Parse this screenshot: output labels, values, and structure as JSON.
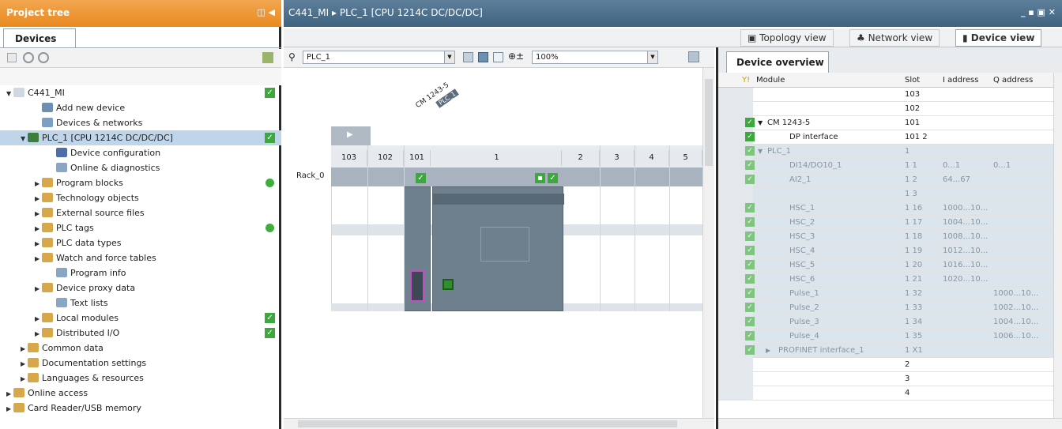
{
  "project_tree": {
    "title": "Project tree",
    "devices_tab": "Devices",
    "items": [
      {
        "label": "C441_MI",
        "indent": 0,
        "arrow": "▼",
        "icon": "project-icon",
        "color": "#cfd8e2",
        "status": "check"
      },
      {
        "label": "Add new device",
        "indent": 2,
        "arrow": "",
        "icon": "add-device-icon",
        "color": "#6d8fb3",
        "status": ""
      },
      {
        "label": "Devices & networks",
        "indent": 2,
        "arrow": "",
        "icon": "network-icon",
        "color": "#7aa0c4",
        "status": ""
      },
      {
        "label": "PLC_1 [CPU 1214C DC/DC/DC]",
        "indent": 1,
        "arrow": "▼",
        "icon": "plc-icon",
        "color": "#3f7d3f",
        "status": "check",
        "selected": true
      },
      {
        "label": "Device configuration",
        "indent": 3,
        "arrow": "",
        "icon": "device-config-icon",
        "color": "#4b6fa6",
        "status": ""
      },
      {
        "label": "Online & diagnostics",
        "indent": 3,
        "arrow": "",
        "icon": "diagnostics-icon",
        "color": "#8aa6c3",
        "status": ""
      },
      {
        "label": "Program blocks",
        "indent": 2,
        "arrow": "▶",
        "icon": "folder-icon",
        "color": "#d6a84a",
        "status": "dot"
      },
      {
        "label": "Technology objects",
        "indent": 2,
        "arrow": "▶",
        "icon": "folder-icon",
        "color": "#d6a84a",
        "status": ""
      },
      {
        "label": "External source files",
        "indent": 2,
        "arrow": "▶",
        "icon": "folder-icon",
        "color": "#d6a84a",
        "status": ""
      },
      {
        "label": "PLC tags",
        "indent": 2,
        "arrow": "▶",
        "icon": "folder-icon",
        "color": "#d6a84a",
        "status": "dot"
      },
      {
        "label": "PLC data types",
        "indent": 2,
        "arrow": "▶",
        "icon": "folder-icon",
        "color": "#d6a84a",
        "status": ""
      },
      {
        "label": "Watch and force tables",
        "indent": 2,
        "arrow": "▶",
        "icon": "folder-icon",
        "color": "#d6a84a",
        "status": ""
      },
      {
        "label": "Program info",
        "indent": 3,
        "arrow": "",
        "icon": "info-icon",
        "color": "#8aa6c3",
        "status": ""
      },
      {
        "label": "Device proxy data",
        "indent": 2,
        "arrow": "▶",
        "icon": "folder-icon",
        "color": "#d6a84a",
        "status": ""
      },
      {
        "label": "Text lists",
        "indent": 3,
        "arrow": "",
        "icon": "list-icon",
        "color": "#8aa6c3",
        "status": ""
      },
      {
        "label": "Local modules",
        "indent": 2,
        "arrow": "▶",
        "icon": "folder-icon",
        "color": "#d6a84a",
        "status": "check"
      },
      {
        "label": "Distributed I/O",
        "indent": 2,
        "arrow": "▶",
        "icon": "folder-icon",
        "color": "#d6a84a",
        "status": "check"
      },
      {
        "label": "Common data",
        "indent": 1,
        "arrow": "▶",
        "icon": "folder-icon",
        "color": "#d6a84a",
        "status": ""
      },
      {
        "label": "Documentation settings",
        "indent": 1,
        "arrow": "▶",
        "icon": "folder-icon",
        "color": "#d6a84a",
        "status": ""
      },
      {
        "label": "Languages & resources",
        "indent": 1,
        "arrow": "▶",
        "icon": "folder-icon",
        "color": "#d6a84a",
        "status": ""
      },
      {
        "label": "Online access",
        "indent": 0,
        "arrow": "▶",
        "icon": "folder-icon",
        "color": "#d6a84a",
        "status": ""
      },
      {
        "label": "Card Reader/USB memory",
        "indent": 0,
        "arrow": "▶",
        "icon": "folder-icon",
        "color": "#d6a84a",
        "status": ""
      }
    ]
  },
  "editor": {
    "breadcrumb": "C441_MI  ▸  PLC_1 [CPU 1214C DC/DC/DC]",
    "views": {
      "topology": "Topology view",
      "network": "Network view",
      "device": "Device view"
    },
    "device_select": "PLC_1",
    "zoom": "100%",
    "rack_label": "Rack_0",
    "module_label_a": "CM 1243-5",
    "module_label_b": "PLC_1",
    "slots": [
      "103",
      "102",
      "101",
      "1",
      "2",
      "3",
      "4",
      "5"
    ]
  },
  "device_overview": {
    "tab": "Device overview",
    "headers": {
      "module": "Module",
      "slot": "Slot",
      "iaddr": "I address",
      "qaddr": "Q address"
    },
    "rows": [
      {
        "module": "",
        "slot": "103",
        "i": "",
        "q": "",
        "chk": false,
        "grey": false,
        "ind": 0,
        "arrow": ""
      },
      {
        "module": "",
        "slot": "102",
        "i": "",
        "q": "",
        "chk": false,
        "grey": false,
        "ind": 0,
        "arrow": ""
      },
      {
        "module": "CM 1243-5",
        "slot": "101",
        "i": "",
        "q": "",
        "chk": true,
        "grey": false,
        "ind": 0,
        "arrow": "▼"
      },
      {
        "module": "DP interface",
        "slot": "101 2",
        "i": "",
        "q": "",
        "chk": true,
        "grey": false,
        "ind": 2,
        "arrow": ""
      },
      {
        "module": "PLC_1",
        "slot": "1",
        "i": "",
        "q": "",
        "chk": true,
        "grey": true,
        "ind": 0,
        "arrow": "▼"
      },
      {
        "module": "DI14/DO10_1",
        "slot": "1 1",
        "i": "0...1",
        "q": "0...1",
        "chk": true,
        "grey": true,
        "ind": 2,
        "arrow": ""
      },
      {
        "module": "AI2_1",
        "slot": "1 2",
        "i": "64...67",
        "q": "",
        "chk": true,
        "grey": true,
        "ind": 2,
        "arrow": ""
      },
      {
        "module": "",
        "slot": "1 3",
        "i": "",
        "q": "",
        "chk": false,
        "grey": true,
        "ind": 2,
        "arrow": ""
      },
      {
        "module": "HSC_1",
        "slot": "1 16",
        "i": "1000...10...",
        "q": "",
        "chk": true,
        "grey": true,
        "ind": 2,
        "arrow": ""
      },
      {
        "module": "HSC_2",
        "slot": "1 17",
        "i": "1004...10...",
        "q": "",
        "chk": true,
        "grey": true,
        "ind": 2,
        "arrow": ""
      },
      {
        "module": "HSC_3",
        "slot": "1 18",
        "i": "1008...10...",
        "q": "",
        "chk": true,
        "grey": true,
        "ind": 2,
        "arrow": ""
      },
      {
        "module": "HSC_4",
        "slot": "1 19",
        "i": "1012...10...",
        "q": "",
        "chk": true,
        "grey": true,
        "ind": 2,
        "arrow": ""
      },
      {
        "module": "HSC_5",
        "slot": "1 20",
        "i": "1016...10...",
        "q": "",
        "chk": true,
        "grey": true,
        "ind": 2,
        "arrow": ""
      },
      {
        "module": "HSC_6",
        "slot": "1 21",
        "i": "1020...10...",
        "q": "",
        "chk": true,
        "grey": true,
        "ind": 2,
        "arrow": ""
      },
      {
        "module": "Pulse_1",
        "slot": "1 32",
        "i": "",
        "q": "1000...10...",
        "chk": true,
        "grey": true,
        "ind": 2,
        "arrow": ""
      },
      {
        "module": "Pulse_2",
        "slot": "1 33",
        "i": "",
        "q": "1002...10...",
        "chk": true,
        "grey": true,
        "ind": 2,
        "arrow": ""
      },
      {
        "module": "Pulse_3",
        "slot": "1 34",
        "i": "",
        "q": "1004...10...",
        "chk": true,
        "grey": true,
        "ind": 2,
        "arrow": ""
      },
      {
        "module": "Pulse_4",
        "slot": "1 35",
        "i": "",
        "q": "1006...10...",
        "chk": true,
        "grey": true,
        "ind": 2,
        "arrow": ""
      },
      {
        "module": "PROFINET interface_1",
        "slot": "1 X1",
        "i": "",
        "q": "",
        "chk": true,
        "grey": true,
        "ind": 1,
        "arrow": "▶"
      },
      {
        "module": "",
        "slot": "2",
        "i": "",
        "q": "",
        "chk": false,
        "grey": false,
        "ind": 0,
        "arrow": ""
      },
      {
        "module": "",
        "slot": "3",
        "i": "",
        "q": "",
        "chk": false,
        "grey": false,
        "ind": 0,
        "arrow": ""
      },
      {
        "module": "",
        "slot": "4",
        "i": "",
        "q": "",
        "chk": false,
        "grey": false,
        "ind": 0,
        "arrow": ""
      }
    ]
  }
}
